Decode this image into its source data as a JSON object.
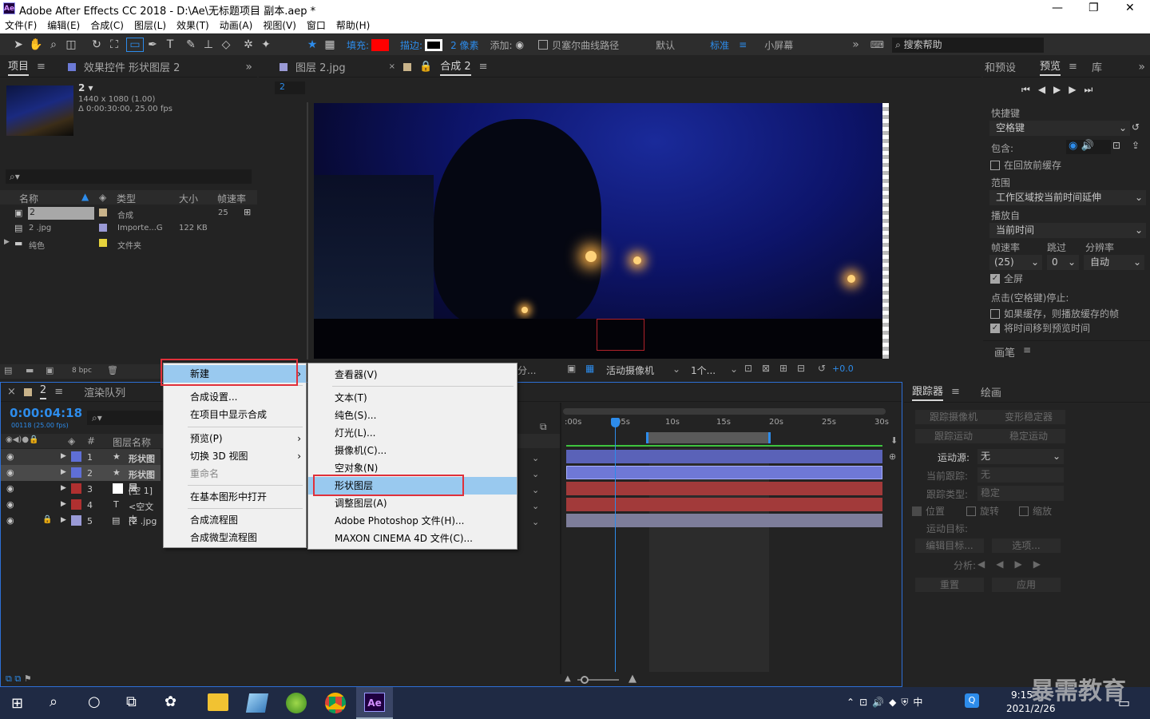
{
  "window": {
    "title": "Adobe After Effects CC 2018 - D:\\Ae\\无标题项目 副本.aep *",
    "app_badge": "Ae"
  },
  "menu": [
    "文件(F)",
    "编辑(E)",
    "合成(C)",
    "图层(L)",
    "效果(T)",
    "动画(A)",
    "视图(V)",
    "窗口",
    "帮助(H)"
  ],
  "toolbar": {
    "fill_label": "填充:",
    "stroke_label": "描边:",
    "stroke_px": "2 像素",
    "add_label": "添加:",
    "bezier_label": "贝塞尔曲线路径",
    "workspaces": [
      "默认",
      "标准",
      "小屏幕"
    ],
    "search_placeholder": "搜索帮助"
  },
  "project": {
    "tab_project": "项目",
    "tab_effects": "效果控件 形状图层 2",
    "comp_name": "2 ▾",
    "comp_res": "1440 x 1080 (1.00)",
    "comp_dur": "Δ 0:00:30:00, 25.00 fps",
    "cols": [
      "名称",
      "类型",
      "大小",
      "帧速率"
    ],
    "items": [
      {
        "name": "2",
        "type": "合成",
        "size": "",
        "fps": "25",
        "color": "#c9b38a"
      },
      {
        "name": "2 .jpg",
        "type": "Importe...G",
        "size": "122 KB",
        "fps": "",
        "color": "#9a9ad6"
      },
      {
        "name": "纯色",
        "type": "文件夹",
        "size": "",
        "fps": "",
        "color": "#e6d33c"
      }
    ],
    "bpc": "8 bpc"
  },
  "viewer": {
    "tab_layer": "图层 2.jpg",
    "tab_comp": "合成 2",
    "comp_crumb": "2",
    "camera": "活动摄像机",
    "views": "1个...",
    "exposure": "+0.0",
    "res": "分..."
  },
  "preview": {
    "tabs": [
      "和预设",
      "预览",
      "库"
    ],
    "shortcut_label": "快捷键",
    "shortcut_val": "空格键",
    "include_label": "包含:",
    "cache_before": "在回放前缓存",
    "range_label": "范围",
    "range_val": "工作区域按当前时间延伸",
    "play_from_label": "播放自",
    "play_from_val": "当前时间",
    "fps_label": "帧速率",
    "skip_label": "跳过",
    "res_label": "分辨率",
    "fps_val": "(25)",
    "skip_val": "0",
    "res_val": "自动",
    "fullscreen": "全屏",
    "stop_label": "点击(空格键)停止:",
    "if_cached": "如果缓存，则播放缓存的帧",
    "move_time": "将时间移到预览时间",
    "paint": "画笔"
  },
  "timeline": {
    "tab": "2",
    "tab_render": "渲染队列",
    "timecode": "0:00:04:18",
    "frames": "00118 (25.00 fps)",
    "col_name": "图层名称",
    "ruler": [
      ":00s",
      "05s",
      "10s",
      "15s",
      "20s",
      "25s",
      "30s"
    ],
    "layers": [
      {
        "num": "1",
        "name": "形状图层",
        "color": "#5f6fd6"
      },
      {
        "num": "2",
        "name": "形状图层",
        "color": "#5f6fd6"
      },
      {
        "num": "3",
        "name": "[空 1]",
        "color": "#b03030"
      },
      {
        "num": "4",
        "name": "<空文本",
        "color": "#b03030"
      },
      {
        "num": "5",
        "name": "[2 .jpg",
        "color": "#9a9ad6"
      }
    ]
  },
  "tracker": {
    "tabs": [
      "跟踪器",
      "绘画"
    ],
    "btn_camera": "跟踪摄像机",
    "btn_warp": "变形稳定器",
    "btn_motion": "跟踪运动",
    "btn_stabilize": "稳定运动",
    "source_label": "运动源:",
    "source_val": "无",
    "current_label": "当前跟踪:",
    "current_val": "无",
    "type_label": "跟踪类型:",
    "type_val": "稳定",
    "opt_pos": "位置",
    "opt_rot": "旋转",
    "opt_scale": "缩放",
    "target_label": "运动目标:",
    "btn_edit": "编辑目标...",
    "btn_options": "选项...",
    "analyze_label": "分析:",
    "btn_reset": "重置",
    "btn_apply": "应用"
  },
  "context_menu": {
    "items": [
      "新建",
      "合成设置...",
      "在项目中显示合成",
      "预览(P)",
      "切换 3D 视图",
      "重命名",
      "在基本图形中打开",
      "合成流程图",
      "合成微型流程图"
    ]
  },
  "submenu": {
    "items": [
      "查看器(V)",
      "文本(T)",
      "纯色(S)...",
      "灯光(L)...",
      "摄像机(C)...",
      "空对象(N)",
      "形状图层",
      "调整图层(A)",
      "Adobe Photoshop 文件(H)...",
      "MAXON CINEMA 4D 文件(C)..."
    ]
  },
  "taskbar": {
    "time": "9:15",
    "date": "2021/2/26",
    "ime": "中"
  },
  "watermark": "暴需教育",
  "colors": {
    "accent": "#2d8ceb",
    "highlight": "#99c9ef",
    "red_box": "#e0303a",
    "fill": "#ff0000"
  }
}
